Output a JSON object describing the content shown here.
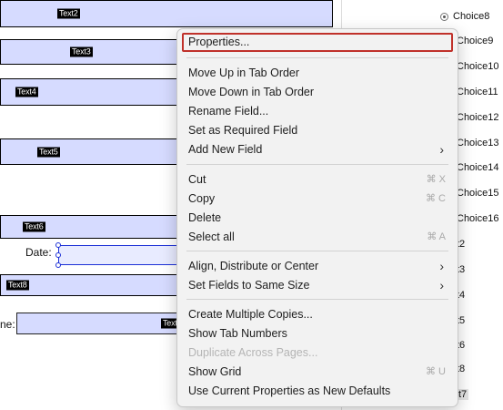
{
  "form": {
    "fields": [
      {
        "tag": "Text2"
      },
      {
        "tag": "Text3"
      },
      {
        "tag": "Text4"
      },
      {
        "tag": "Text5"
      },
      {
        "tag": "Text6"
      },
      {
        "tag": "Text8"
      },
      {
        "tag": "Text"
      }
    ],
    "date_label": "Date:",
    "name_label_fragment": "ne:"
  },
  "right_panel": {
    "items": [
      "Choice8",
      "Choice9",
      "Choice10",
      "Choice11",
      "Choice12",
      "Choice13",
      "Choice14",
      "Choice15",
      "Choice16",
      "t2",
      "t3",
      "t4",
      "t5",
      "t6",
      "t8",
      "t7"
    ]
  },
  "context_menu": {
    "groups": [
      [
        {
          "label": "Properties...",
          "highlighted": true
        }
      ],
      [
        {
          "label": "Move Up in Tab Order"
        },
        {
          "label": "Move Down in Tab Order"
        },
        {
          "label": "Rename Field..."
        },
        {
          "label": "Set as Required Field"
        },
        {
          "label": "Add New Field",
          "submenu": true
        }
      ],
      [
        {
          "label": "Cut",
          "shortcut": "⌘ X"
        },
        {
          "label": "Copy",
          "shortcut": "⌘ C"
        },
        {
          "label": "Delete"
        },
        {
          "label": "Select all",
          "shortcut": "⌘ A"
        }
      ],
      [
        {
          "label": "Align, Distribute or Center",
          "submenu": true
        },
        {
          "label": "Set Fields to Same Size",
          "submenu": true
        }
      ],
      [
        {
          "label": "Create Multiple Copies..."
        },
        {
          "label": "Show Tab Numbers"
        },
        {
          "label": "Duplicate Across Pages...",
          "disabled": true
        },
        {
          "label": "Show Grid",
          "shortcut": "⌘ U"
        },
        {
          "label": "Use Current Properties as New Defaults"
        }
      ]
    ],
    "submenu_arrow": "›"
  },
  "colors": {
    "field_fill": "#d6dbff",
    "highlight_border": "#c0312a",
    "selection_blue": "#1b2fd6"
  }
}
